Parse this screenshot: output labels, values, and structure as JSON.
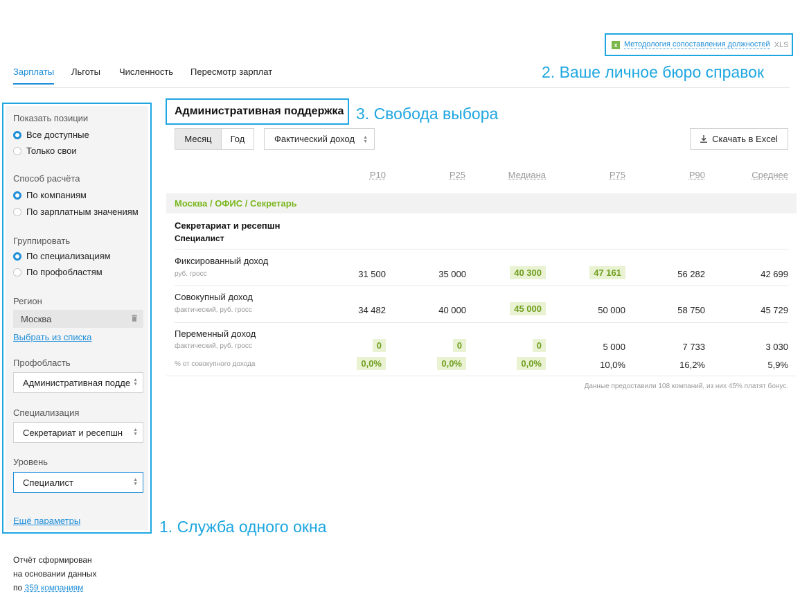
{
  "top_link": {
    "text": "Методология сопоставления должностей",
    "ext": "XLS",
    "icon": "excel-icon"
  },
  "annotations": {
    "one": "1. Служба одного окна",
    "two": "2. Ваше личное бюро справок",
    "three": "3. Свобода выбора"
  },
  "tabs": [
    "Зарплаты",
    "Льготы",
    "Численность",
    "Пересмотр зарплат"
  ],
  "sidebar": {
    "show_positions": {
      "label": "Показать позиции",
      "options": [
        "Все доступные",
        "Только свои"
      ],
      "selected": 0
    },
    "calc_method": {
      "label": "Способ расчёта",
      "options": [
        "По компаниям",
        "По зарплатным значениям"
      ],
      "selected": 0
    },
    "grouping": {
      "label": "Группировать",
      "options": [
        "По специализациям",
        "По профобластям"
      ],
      "selected": 0
    },
    "region": {
      "label": "Регион",
      "value": "Москва",
      "choose_link": "Выбрать из списка"
    },
    "prof_area": {
      "label": "Профобласть",
      "value": "Административная подде"
    },
    "specialization": {
      "label": "Специализация",
      "value": "Секретариат и ресепшн"
    },
    "level": {
      "label": "Уровень",
      "value": "Специалист"
    },
    "more_params": "Ещё параметры"
  },
  "report": {
    "line1": "Отчёт сформирован",
    "line2": "на основании данных",
    "prefix": "по",
    "link": "359 компаниям"
  },
  "main": {
    "title": "Административная поддержка",
    "period": {
      "month": "Месяц",
      "year": "Год",
      "selected": "month"
    },
    "income_select": "Фактический доход",
    "download": "Скачать в Excel",
    "columns": [
      "P10",
      "P25",
      "Медиана",
      "P75",
      "P90",
      "Среднее"
    ],
    "group": "Москва / ОФИС / Секретарь",
    "position_title": "Секретариат и ресепшн",
    "position_level": "Специалист",
    "rows": [
      {
        "title": "Фиксированный доход",
        "sub": "руб. гросс",
        "values": [
          "31 500",
          "35 000",
          "40 300",
          "47 161",
          "56 282",
          "42 699"
        ]
      },
      {
        "title": "Совокупный доход",
        "sub": "фактический, руб. гросс",
        "values": [
          "34 482",
          "40 000",
          "45 000",
          "50 000",
          "58 750",
          "45 729"
        ]
      },
      {
        "title": "Переменный доход",
        "sub": "фактический, руб. гросс",
        "values": [
          "0",
          "0",
          "0",
          "5 000",
          "7 733",
          "3 030"
        ]
      }
    ],
    "percent_row": {
      "sub": "% от совокупного дохода",
      "values": [
        "0,0%",
        "0,0%",
        "0,0%",
        "10,0%",
        "16,2%",
        "5,9%"
      ]
    },
    "footnote": "Данные предоставили 108 компаний, из них 45% платят бонус."
  }
}
